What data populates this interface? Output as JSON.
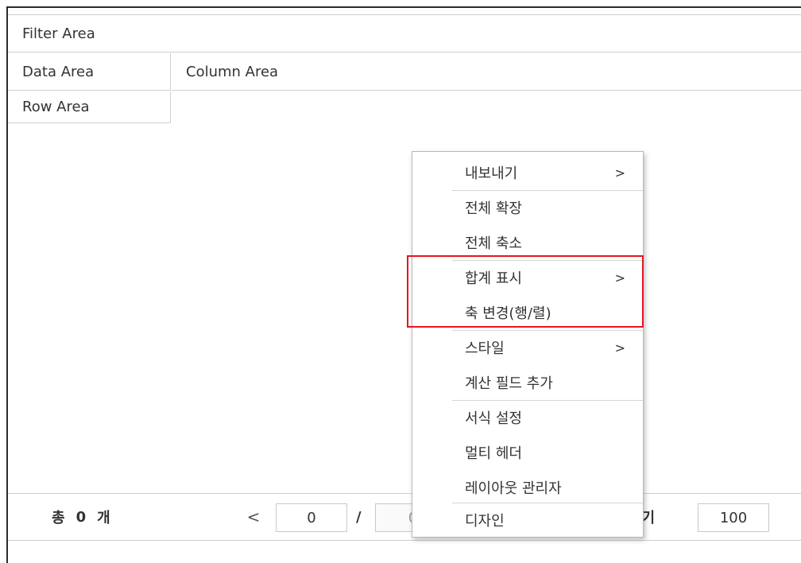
{
  "pivot": {
    "filter_area": "Filter Area",
    "data_area": "Data Area",
    "column_area": "Column Area",
    "row_area": "Row Area"
  },
  "footer": {
    "total_prefix": "총",
    "total_count": "0",
    "total_suffix": "개",
    "prev": "<",
    "page_current": "0",
    "separator": "/",
    "page_total": "0",
    "next": ">",
    "page_size_label": "페이지 크기",
    "page_size": "100"
  },
  "context_menu": {
    "items": [
      {
        "label": "내보내기",
        "submenu": true,
        "chevron": ">"
      },
      {
        "label": "전체 확장",
        "submenu": false
      },
      {
        "label": "전체 축소",
        "submenu": false
      },
      {
        "label": "합계 표시",
        "submenu": true,
        "chevron": ">"
      },
      {
        "label": "축 변경(행/렬)",
        "submenu": false
      },
      {
        "label": "스타일",
        "submenu": true,
        "chevron": ">"
      },
      {
        "label": "계산 필드 추가",
        "submenu": false
      },
      {
        "label": "서식 설정",
        "submenu": false
      },
      {
        "label": "멀티 헤더",
        "submenu": false
      },
      {
        "label": "레이아웃 관리자",
        "submenu": false
      },
      {
        "label": "디자인",
        "submenu": false
      }
    ]
  },
  "colors": {
    "highlight": "#e8141f",
    "border": "#cfcfcf"
  }
}
